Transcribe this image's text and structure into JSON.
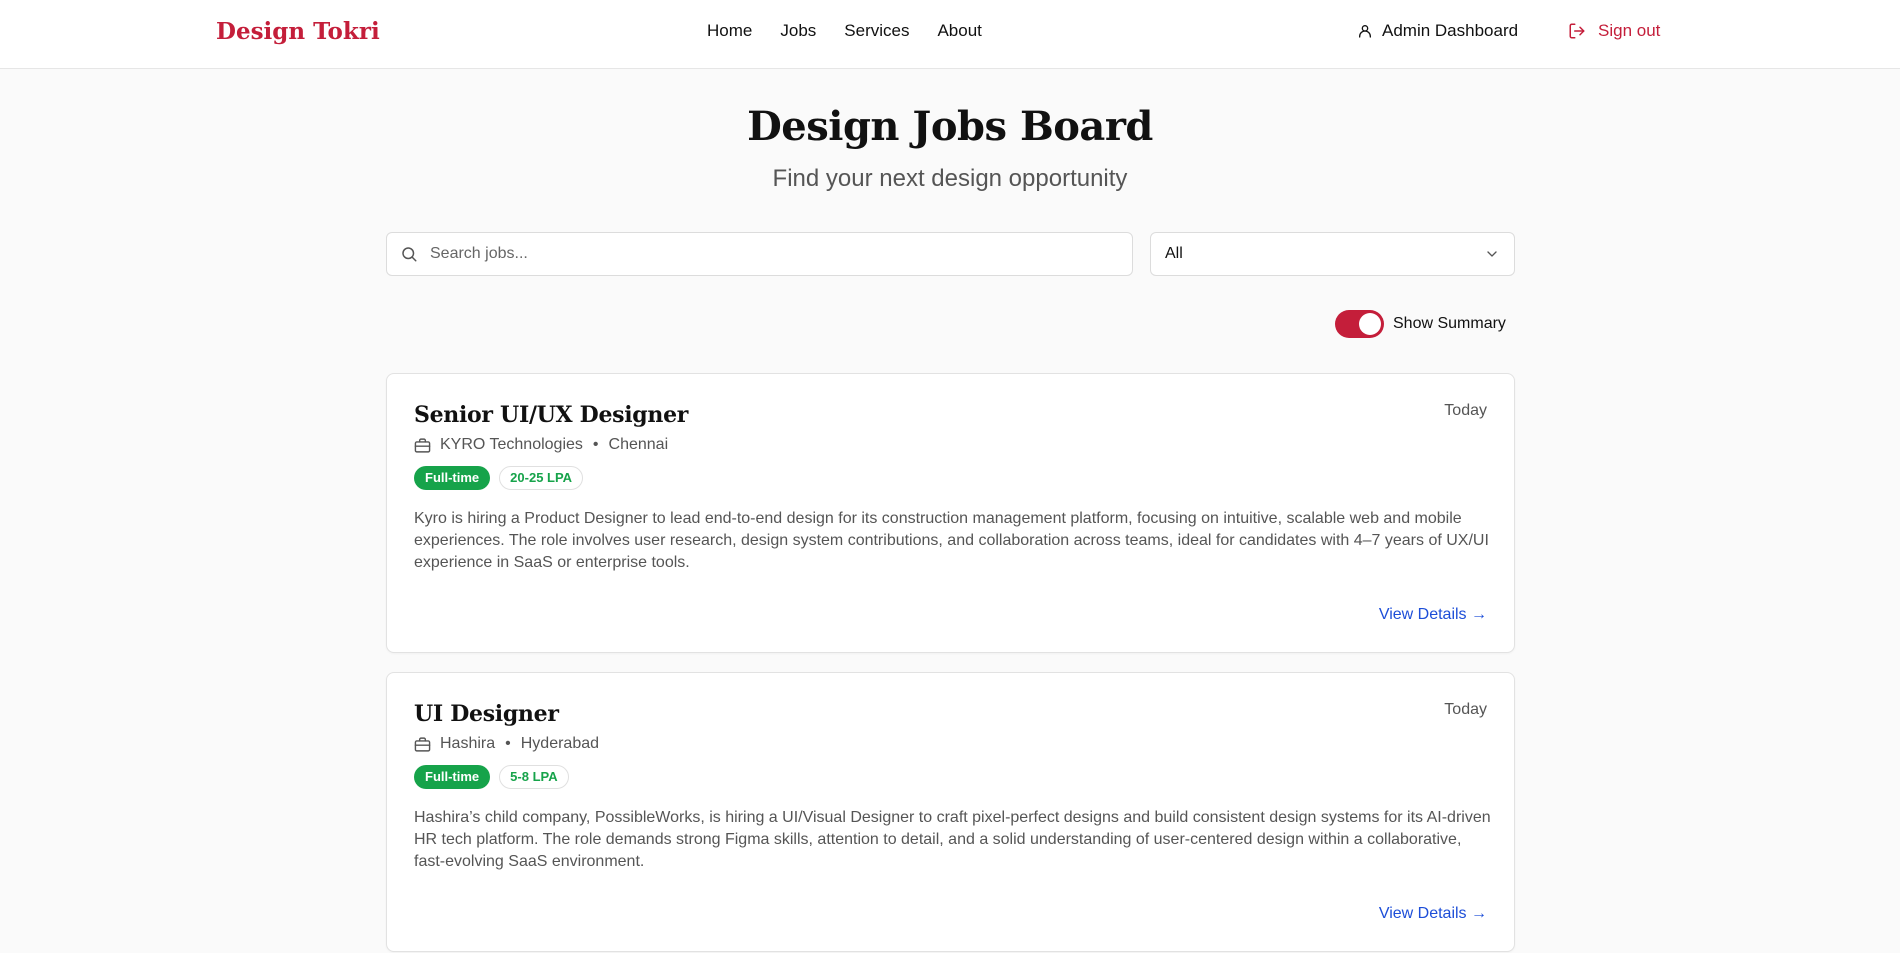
{
  "header": {
    "logo": "Design Tokri",
    "nav": [
      "Home",
      "Jobs",
      "Services",
      "About"
    ],
    "admin_label": "Admin Dashboard",
    "signout_label": "Sign out"
  },
  "hero": {
    "title": "Design Jobs Board",
    "subtitle": "Find your next design opportunity"
  },
  "filters": {
    "search_placeholder": "Search jobs...",
    "search_value": "",
    "type_selected": "All",
    "toggle_label": "Show Summary",
    "toggle_on": true
  },
  "jobs": [
    {
      "title": "Senior UI/UX Designer",
      "date": "Today",
      "company": "KYRO Technologies",
      "location": "Chennai",
      "type": "Full-time",
      "salary": "20-25 LPA",
      "summary": "Kyro is hiring a Product Designer to lead end-to-end design for its construction management platform, focusing on intuitive, scalable web and mobile experiences. The role involves user research, design system contributions, and collaboration across teams, ideal for candidates with 4–7 years of UX/UI experience in SaaS or enterprise tools.",
      "link": "View Details →"
    },
    {
      "title": "UI Designer",
      "date": "Today",
      "company": "Hashira",
      "location": "Hyderabad",
      "type": "Full-time",
      "salary": "5-8 LPA",
      "summary": "Hashira’s child company, PossibleWorks, is hiring a UI/Visual Designer to craft pixel-perfect designs and build consistent design systems for its AI-driven HR tech platform. The role demands strong Figma skills, attention to detail, and a solid understanding of user-centered design within a collaborative, fast-evolving SaaS environment.",
      "link": "View Details →"
    }
  ],
  "colors": {
    "brand": "#c41e3a",
    "badge_green": "#16a34a",
    "link_blue": "#1d4ed8"
  },
  "icons": [
    "user-icon",
    "sign-out-icon",
    "search-icon",
    "chevron-down-icon",
    "briefcase-icon"
  ]
}
